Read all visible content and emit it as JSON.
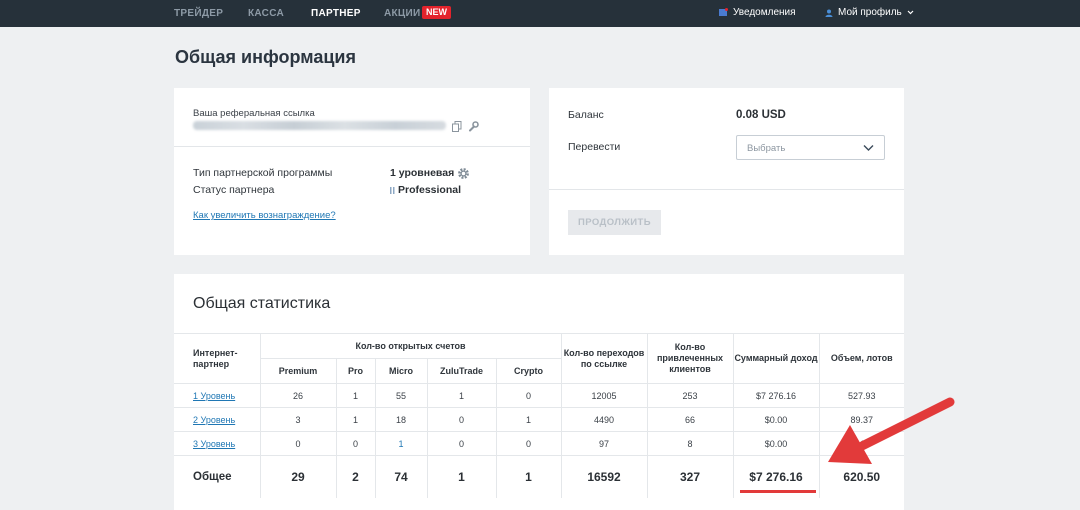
{
  "nav": {
    "items": [
      "ТРЕЙДЕР",
      "КАССА",
      "ПАРТНЕР",
      "АКЦИИ"
    ],
    "new_badge": "NEW",
    "notifications": "Уведомления",
    "profile": "Мой профиль"
  },
  "page_title": "Общая информация",
  "referral": {
    "link_label": "Ваша реферальная ссылка",
    "program_type_label": "Тип партнерской программы",
    "program_type_value": "1 уровневая",
    "partner_status_label": "Статус партнера",
    "partner_status_value": "Professional",
    "increase_link": "Как увеличить вознаграждение?"
  },
  "balance": {
    "balance_label": "Баланс",
    "balance_value": "0.08 USD",
    "transfer_label": "Перевести",
    "select_placeholder": "Выбрать",
    "continue_button": "ПРОДОЛЖИТЬ"
  },
  "stats": {
    "title": "Общая статистика",
    "headers": {
      "partner": "Интернет-партнер",
      "open_accounts": "Кол-во открытых счетов",
      "premium": "Premium",
      "pro": "Pro",
      "micro": "Micro",
      "zulutrade": "ZuluTrade",
      "crypto": "Crypto",
      "clicks": "Кол-во переходов по ссылке",
      "clients": "Кол-во привлеченных клиентов",
      "income": "Суммарный доход",
      "volume": "Объем, лотов"
    },
    "rows": [
      {
        "level": "1 Уровень",
        "premium": "26",
        "pro": "1",
        "micro": "55",
        "zulutrade": "1",
        "crypto": "0",
        "clicks": "12005",
        "clients": "253",
        "income": "$7 276.16",
        "volume": "527.93"
      },
      {
        "level": "2 Уровень",
        "premium": "3",
        "pro": "1",
        "micro": "18",
        "zulutrade": "0",
        "crypto": "1",
        "clicks": "4490",
        "clients": "66",
        "income": "$0.00",
        "volume": "89.37"
      },
      {
        "level": "3 Уровень",
        "premium": "0",
        "pro": "0",
        "micro": "1",
        "zulutrade": "0",
        "crypto": "0",
        "clicks": "97",
        "clients": "8",
        "income": "$0.00",
        "volume": "3.20"
      }
    ],
    "total": {
      "label": "Общее",
      "premium": "29",
      "pro": "2",
      "micro": "74",
      "zulutrade": "1",
      "crypto": "1",
      "clicks": "16592",
      "clients": "327",
      "income": "$7 276.16",
      "volume": "620.50"
    }
  },
  "colors": {
    "topbar": "#26313a",
    "accent_link": "#1f77b4",
    "badge_red": "#e3232c",
    "annotation_red": "#e23a3a"
  }
}
